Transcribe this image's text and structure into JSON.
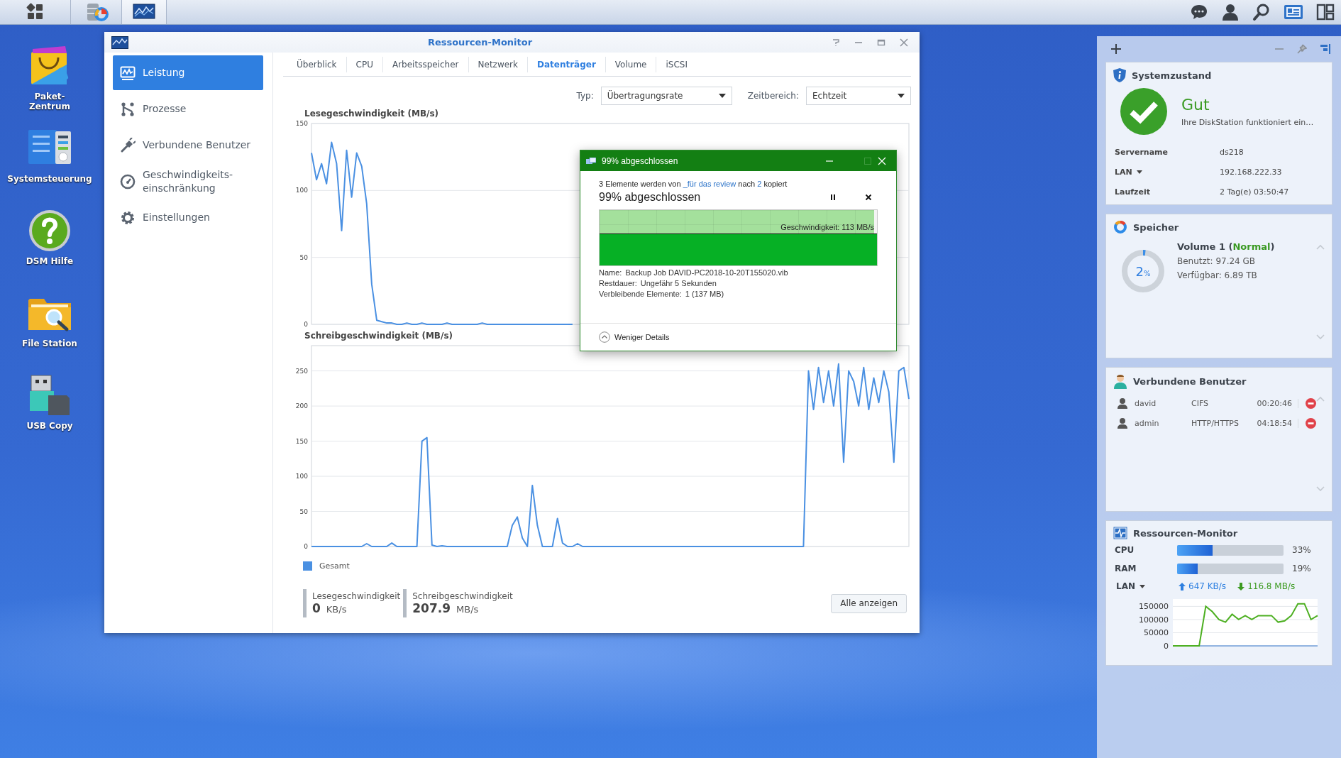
{
  "desktop_icons": [
    {
      "kind": "package",
      "label": "Paket-\nZentrum"
    },
    {
      "kind": "control",
      "label": "Systemsteuerung"
    },
    {
      "kind": "help",
      "label": "DSM Hilfe"
    },
    {
      "kind": "folder",
      "label": "File Station"
    },
    {
      "kind": "usb",
      "label": "USB Copy"
    }
  ],
  "window": {
    "title": "Ressourcen-Monitor",
    "sidebar": [
      {
        "kind": "performance",
        "label": "Leistung",
        "selected": true
      },
      {
        "kind": "process",
        "label": "Prozesse",
        "selected": false
      },
      {
        "kind": "plug",
        "label": "Verbundene Benutzer",
        "selected": false
      },
      {
        "kind": "speed",
        "label": "Geschwindigkeits-\neinschränkung",
        "selected": false
      },
      {
        "kind": "gear",
        "label": "Einstellungen",
        "selected": false
      }
    ],
    "tabs": [
      {
        "label": "Überblick",
        "selected": false
      },
      {
        "label": "CPU",
        "selected": false
      },
      {
        "label": "Arbeitsspeicher",
        "selected": false
      },
      {
        "label": "Netzwerk",
        "selected": false
      },
      {
        "label": "Datenträger",
        "selected": true
      },
      {
        "label": "Volume",
        "selected": false
      },
      {
        "label": "iSCSI",
        "selected": false
      }
    ],
    "filters": [
      {
        "label": "Typ:",
        "value": "Übertragungsrate"
      },
      {
        "label": "Zeitbereich:",
        "value": "Echtzeit"
      }
    ],
    "charts": [
      {
        "chart_data": {
          "type": "line",
          "title": "Lesegeschwindigkeit (MB/s)",
          "ylim": [
            0,
            150
          ],
          "yticks": [
            0,
            50,
            100,
            150
          ],
          "grid": true,
          "series": [
            {
              "name": "Gesamt",
              "color": "#4a90e2",
              "values": [
                128,
                108,
                120,
                105,
                136,
                120,
                70,
                130,
                95,
                128,
                118,
                90,
                30,
                3,
                2,
                1,
                1,
                0,
                0,
                1,
                0,
                0,
                1,
                0,
                0,
                0,
                0,
                1,
                0,
                0,
                0,
                0,
                0,
                0,
                1,
                0,
                0,
                0,
                0,
                0,
                0,
                0,
                0,
                0,
                0,
                0,
                0,
                0,
                0,
                0,
                0,
                0,
                0,
                null,
                null,
                null,
                null,
                null,
                null,
                null,
                null,
                null,
                null,
                null,
                null,
                null,
                null,
                null,
                null,
                null,
                null,
                null,
                null,
                null,
                null,
                null,
                null,
                null,
                null,
                null,
                null,
                null,
                null,
                null,
                null,
                null,
                null,
                null,
                null,
                null,
                null,
                null,
                null,
                null,
                null,
                null,
                null,
                null,
                null,
                null,
                null,
                null,
                null,
                null,
                null,
                null,
                null,
                null,
                null,
                null,
                null,
                null,
                null,
                null,
                null,
                null,
                null,
                null,
                null,
                null
              ]
            }
          ]
        }
      },
      {
        "chart_data": {
          "type": "line",
          "title": "Schreibgeschwindigkeit (MB/s)",
          "ylim": [
            0,
            286
          ],
          "yticks": [
            0,
            50,
            100,
            150,
            200,
            250
          ],
          "grid": true,
          "series": [
            {
              "color": "#4a90e2",
              "values": [
                0,
                0,
                0,
                0,
                0,
                0,
                0,
                0,
                0,
                0,
                0,
                4,
                0,
                0,
                0,
                0,
                5,
                0,
                0,
                0,
                0,
                0,
                150,
                155,
                2,
                0,
                1,
                0,
                0,
                0,
                0,
                0,
                0,
                0,
                0,
                0,
                0,
                0,
                0,
                0,
                30,
                42,
                12,
                0,
                87,
                30,
                0,
                0,
                0,
                40,
                5,
                0,
                0,
                4,
                0,
                0,
                0,
                0,
                0,
                0,
                0,
                0,
                0,
                0,
                0,
                0,
                0,
                0,
                0,
                0,
                0,
                0,
                0,
                0,
                0,
                0,
                0,
                0,
                0,
                0,
                0,
                0,
                0,
                0,
                0,
                0,
                0,
                0,
                0,
                0,
                0,
                0,
                0,
                0,
                0,
                0,
                0,
                0,
                0,
                250,
                195,
                255,
                205,
                250,
                200,
                260,
                120,
                250,
                235,
                200,
                255,
                195,
                240,
                205,
                250,
                220,
                120,
                250,
                255,
                210
              ]
            }
          ]
        }
      }
    ],
    "stats": [
      {
        "label": "Lesegeschwindigkeit",
        "value": "0",
        "unit": "KB/s"
      },
      {
        "label": "Schreibgeschwindigkeit",
        "value": "207.9",
        "unit": "MB/s"
      }
    ],
    "button": "Alle anzeigen"
  },
  "copy_dialog": {
    "title": "99% abgeschlossen",
    "summary": {
      "prefix": "3 Elemente werden von",
      "source": "_für das review",
      "middle": "nach",
      "target": "2",
      "suffix": "kopiert"
    },
    "heading": "99% abgeschlossen",
    "level": 0.99,
    "speed": "Geschwindigkeit: 113 MB/s",
    "details": [
      {
        "label": "Name:",
        "value": "Backup Job DAVID-PC2018-10-20T155020.vib"
      },
      {
        "label": "Restdauer:",
        "value": "Ungefähr 5 Sekunden"
      },
      {
        "label": "Verbleibende Elemente:",
        "value": "1 (137 MB)"
      }
    ],
    "toggle": "Weniger Details"
  },
  "widgets": {
    "system": {
      "title": "Systemzustand",
      "status": "Gut",
      "message": "Ihre DiskStation funktioniert ein…",
      "rows": [
        {
          "label": "Servername",
          "value": "ds218",
          "dropdown": false
        },
        {
          "label": "LAN",
          "value": "192.168.222.33",
          "dropdown": true
        },
        {
          "label": "Laufzeit",
          "value": "2 Tag(e) 03:50:47",
          "dropdown": false
        }
      ]
    },
    "storage": {
      "title": "Speicher",
      "percent": "2",
      "unit": "%",
      "level": 0.02,
      "name": "Volume 1 (",
      "status": "Normal",
      "name_end": ")",
      "used": "Benutzt: 97.24 GB",
      "free": "Verfügbar: 6.89 TB"
    },
    "users": {
      "title": "Verbundene Benutzer",
      "rows": [
        {
          "name": "david",
          "protocol": "CIFS",
          "time": "00:20:46"
        },
        {
          "name": "admin",
          "protocol": "HTTP/HTTPS",
          "time": "04:18:54"
        }
      ]
    },
    "monitor": {
      "title": "Ressourcen-Monitor",
      "meters": [
        {
          "label": "CPU",
          "level": 0.33,
          "reading": "33%"
        },
        {
          "label": "RAM",
          "level": 0.19,
          "reading": "19%"
        }
      ],
      "lan": {
        "label": "LAN",
        "upload": "647 KB/s",
        "download": "116.8 MB/s"
      },
      "chart_data": {
        "type": "line",
        "ylim": [
          0,
          178000
        ],
        "yticks": [
          0,
          50000,
          100000,
          150000
        ],
        "grid": true,
        "series": [
          {
            "color": "#4caf20",
            "values": [
              0,
              0,
              0,
              0,
              0,
              150000,
              130000,
              100000,
              90000,
              120000,
              100000,
              115000,
              100000,
              115000,
              115000,
              115000,
              90000,
              95000,
              115000,
              160000,
              160000,
              100000,
              115000
            ]
          }
        ]
      }
    }
  }
}
